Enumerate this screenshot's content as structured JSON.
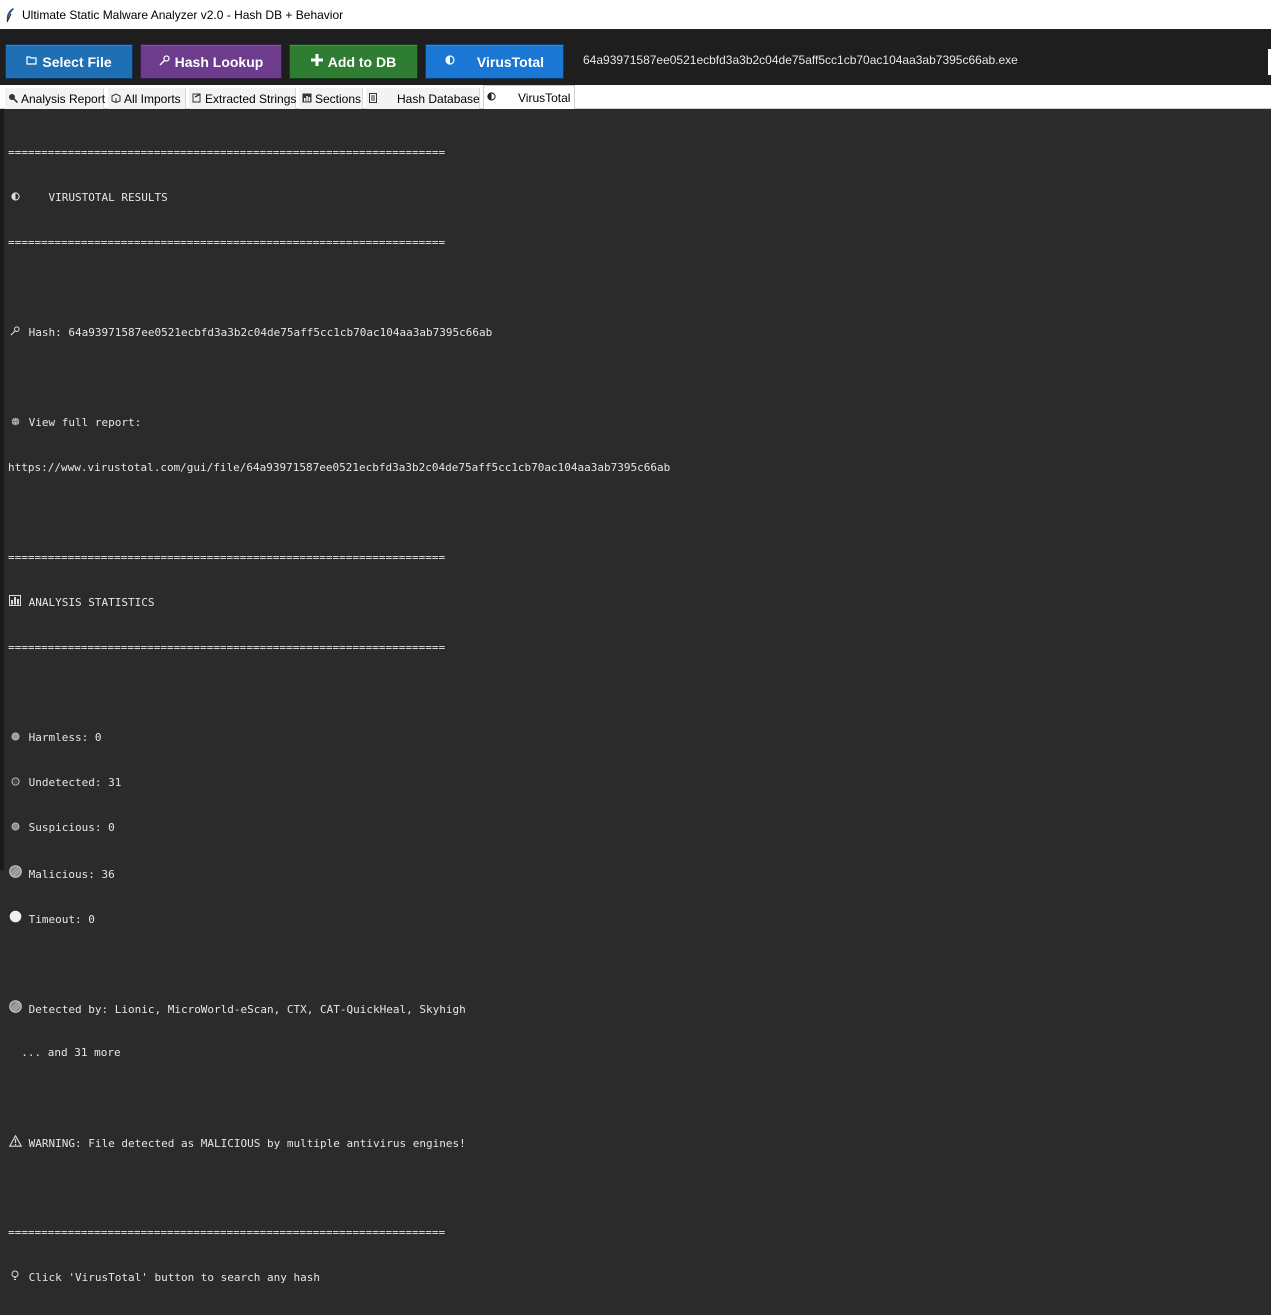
{
  "window": {
    "title": "Ultimate Static Malware Analyzer v2.0 - Hash DB + Behavior",
    "app_icon": "feather-icon"
  },
  "toolbar": {
    "select_file": "Select File",
    "hash_lookup": "Hash Lookup",
    "add_to_db": "Add to DB",
    "virustotal": "VirusTotal",
    "current_file": "64a93971587ee0521ecbfd3a3b2c04de75aff5cc1cb70ac104aa3ab7395c66ab.exe",
    "colors": {
      "select_file": "#1f6fb5",
      "hash_lookup": "#6e3c8d",
      "add_to_db": "#2e7d32",
      "virustotal": "#1a78d4"
    }
  },
  "tabs": [
    {
      "label": "Analysis Report",
      "icon": "magnifier-icon"
    },
    {
      "label": "All Imports",
      "icon": "package-icon"
    },
    {
      "label": "Extracted Strings",
      "icon": "memo-icon"
    },
    {
      "label": "Sections",
      "icon": "chart-icon"
    },
    {
      "label": "Hash Database",
      "icon": "database-icon"
    },
    {
      "label": "VirusTotal",
      "icon": "half-circle-icon",
      "active": true
    }
  ],
  "report": {
    "separator": "==================================================================",
    "vt_header": "VIRUSTOTAL RESULTS",
    "hash_line": "Hash: 64a93971587ee0521ecbfd3a3b2c04de75aff5cc1cb70ac104aa3ab7395c66ab",
    "view_report_label": "View full report:",
    "report_url": "https://www.virustotal.com/gui/file/64a93971587ee0521ecbfd3a3b2c04de75aff5cc1cb70ac104aa3ab7395c66ab",
    "stats_header": "ANALYSIS STATISTICS",
    "stats": {
      "harmless": "Harmless: 0",
      "undetected": "Undetected: 31",
      "suspicious": "Suspicious: 0",
      "malicious": "Malicious: 36",
      "timeout": "Timeout: 0"
    },
    "detected_by": "Detected by: Lionic, MicroWorld-eScan, CTX, CAT-QuickHeal, Skyhigh",
    "more": "  ... and 31 more",
    "warning": "WARNING: File detected as MALICIOUS by multiple antivirus engines!",
    "tip": "Click 'VirusTotal' button to search any hash"
  }
}
